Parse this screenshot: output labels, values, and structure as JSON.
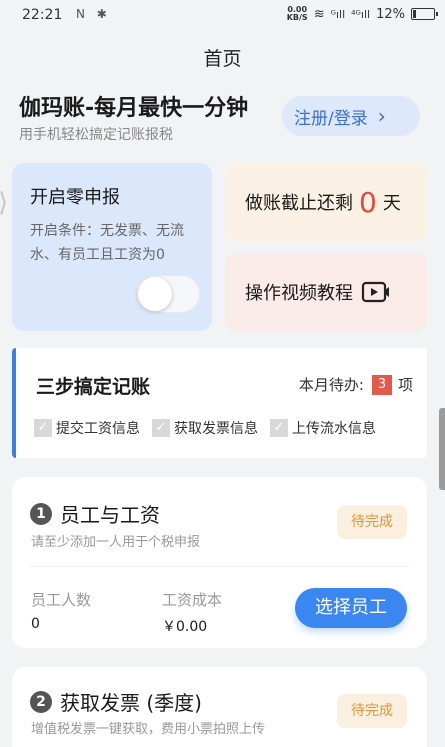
{
  "statusbar": {
    "time": "22:21",
    "left_icons": "N ✱",
    "speed_value": "0.00",
    "speed_unit": "KB/S",
    "wifi": "≋",
    "signal1": "ᴳıll",
    "signal2": "⁴ᴳıll",
    "battery": "12%"
  },
  "navbar": {
    "title": "首页"
  },
  "hero": {
    "title": "伽玛账-每月最快一分钟",
    "subtitle": "用手机轻松搞定记账报税",
    "login_label": "注册/登录",
    "login_chevron": "›"
  },
  "zero_report": {
    "title": "开启零申报",
    "desc": "开启条件：无发票、无流水、有员工且工资为0",
    "toggle_on": false
  },
  "deadline": {
    "prefix": "做账截止还剩",
    "days": "0",
    "suffix": "天"
  },
  "video": {
    "label": "操作视频教程",
    "icon": "video-play-icon"
  },
  "steps": {
    "title": "三步搞定记账",
    "pending_label": "本月待办:",
    "pending_count": "3",
    "pending_unit": "项",
    "items": [
      {
        "label": "提交工资信息"
      },
      {
        "label": "获取发票信息"
      },
      {
        "label": "上传流水信息"
      }
    ]
  },
  "employee_card": {
    "number": "1",
    "title": "员工与工资",
    "subtitle": "请至少添加一人用于个税申报",
    "status": "待完成",
    "stat1_label": "员工人数",
    "stat1_value": "0",
    "stat2_label": "工资成本",
    "stat2_value": "￥0.00",
    "button": "选择员工"
  },
  "invoice_card": {
    "number": "2",
    "title": "获取发票 (季度)",
    "subtitle": "增值税发票一键获取，费用小票拍照上传",
    "status": "待完成"
  },
  "colors": {
    "accent": "#3b87f1",
    "warning": "#e1953c",
    "danger": "#e24a3b"
  }
}
